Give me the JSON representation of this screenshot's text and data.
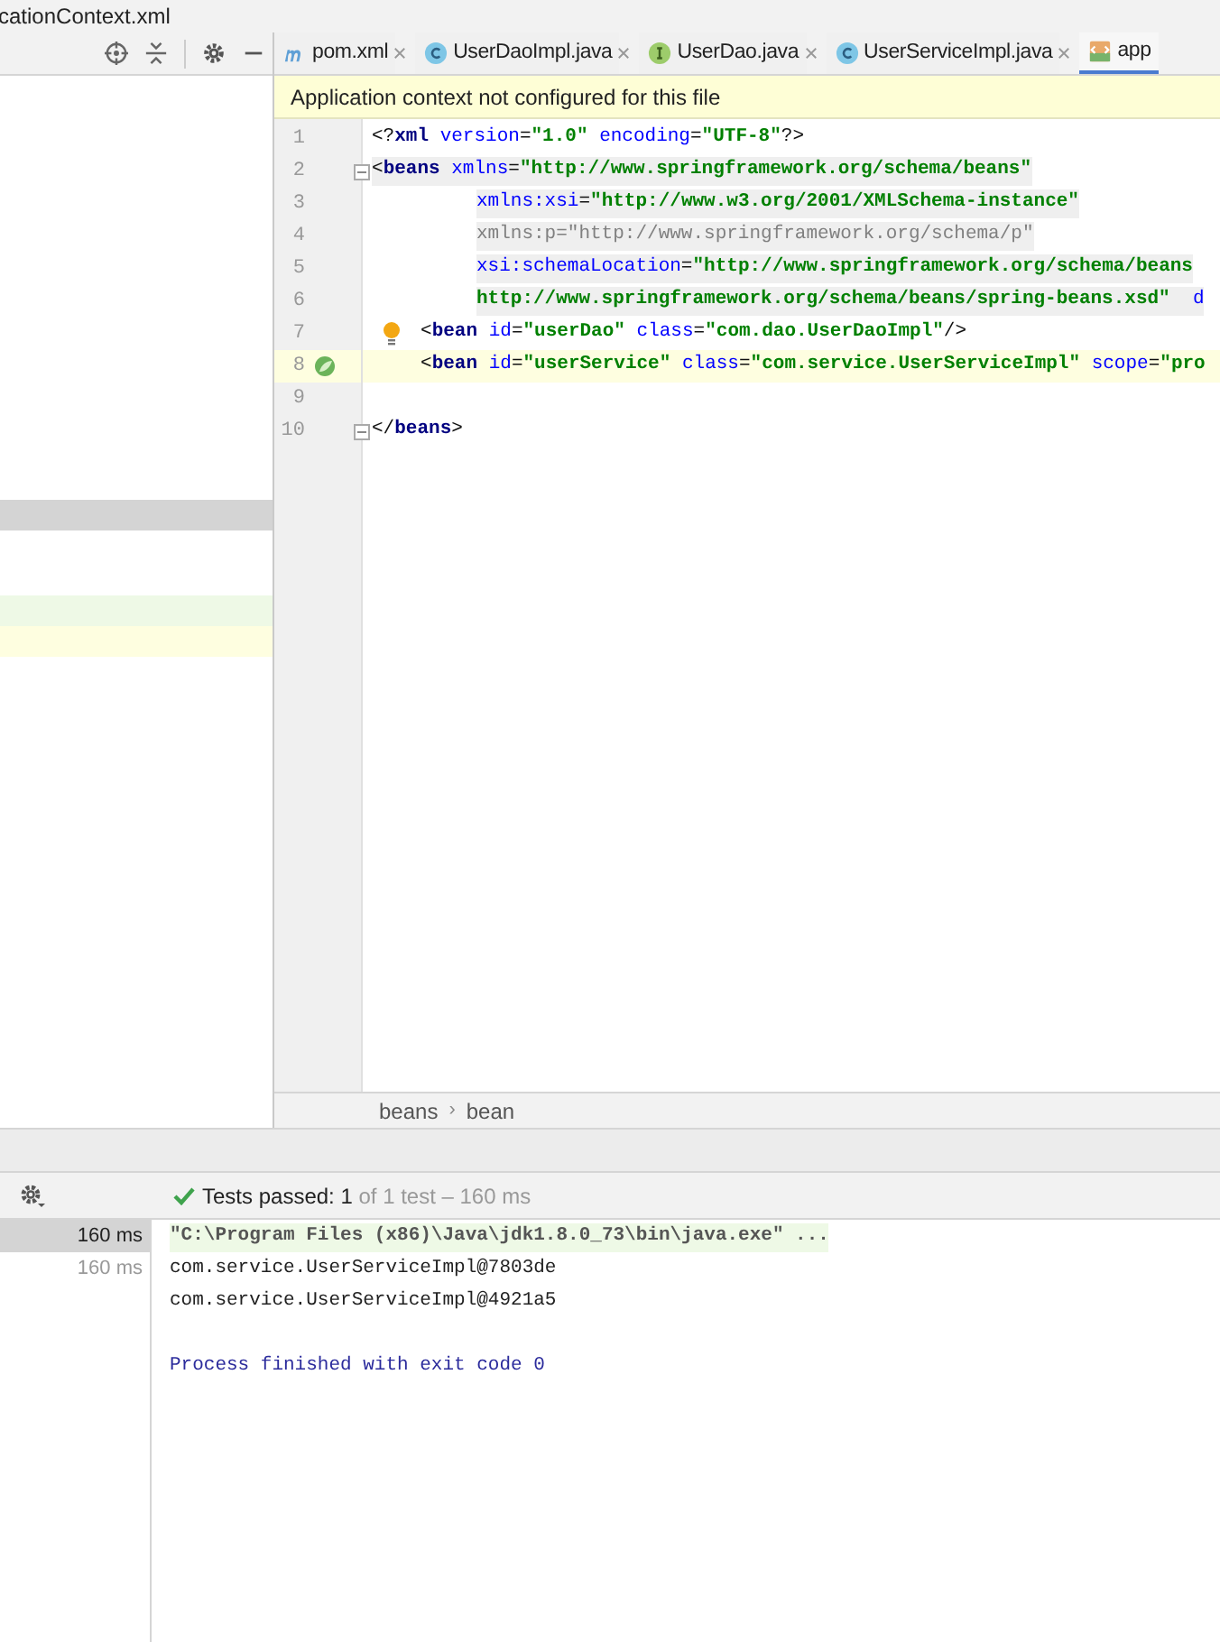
{
  "window": {
    "title": "cationContext.xml"
  },
  "project_panel": {
    "tools": [
      {
        "kind": "locate"
      },
      {
        "kind": "collapse"
      },
      {
        "kind": "settings"
      },
      {
        "kind": "hide"
      }
    ],
    "rows": [
      {
        "kind": "selected"
      },
      {
        "kind": "blank"
      },
      {
        "kind": "blank"
      },
      {
        "kind": "passed"
      },
      {
        "kind": "current"
      }
    ]
  },
  "tabs": [
    {
      "label": "pom.xml",
      "kind": "maven",
      "selected": false,
      "closable": true
    },
    {
      "label": "UserDaoImpl.java",
      "kind": "class",
      "selected": false,
      "closable": true
    },
    {
      "label": "UserDao.java",
      "kind": "interface",
      "selected": false,
      "closable": true
    },
    {
      "label": "UserServiceImpl.java",
      "kind": "class",
      "selected": false,
      "closable": true
    },
    {
      "label": "app",
      "kind": "xml",
      "selected": true,
      "closable": false
    }
  ],
  "banner": "Application context not configured for this file",
  "editor": {
    "lines": [
      {
        "number": "1",
        "kind": "root",
        "fold": false,
        "scope": false,
        "current": false,
        "tokens": [
          {
            "kind": "p",
            "text": "<?"
          },
          {
            "kind": "t",
            "text": "xml"
          },
          {
            "kind": "a",
            "text": " version"
          },
          {
            "kind": "p",
            "text": "="
          },
          {
            "kind": "v",
            "text": "\"1.0\""
          },
          {
            "kind": "a",
            "text": " encoding"
          },
          {
            "kind": "p",
            "text": "="
          },
          {
            "kind": "v",
            "text": "\"UTF-8\""
          },
          {
            "kind": "p",
            "text": "?>"
          }
        ]
      },
      {
        "number": "2",
        "kind": "root",
        "fold": true,
        "scope": true,
        "current": false,
        "tokens": [
          {
            "kind": "p",
            "text": "<"
          },
          {
            "kind": "t",
            "text": "beans"
          },
          {
            "kind": "a",
            "text": " xmlns"
          },
          {
            "kind": "p",
            "text": "="
          },
          {
            "kind": "v",
            "text": "\"http://www.springframework.org/schema/beans\""
          }
        ]
      },
      {
        "number": "3",
        "kind": "continuation",
        "fold": false,
        "scope": true,
        "current": false,
        "tokens": [
          {
            "kind": "a",
            "text": "xmlns:xsi"
          },
          {
            "kind": "p",
            "text": "="
          },
          {
            "kind": "v",
            "text": "\"http://www.w3.org/2001/XMLSchema-instance\""
          }
        ]
      },
      {
        "number": "4",
        "kind": "continuation",
        "fold": false,
        "scope": true,
        "current": false,
        "tokens": [
          {
            "kind": "d",
            "text": "xmlns:p=\"http://www.springframework.org/schema/p\""
          }
        ]
      },
      {
        "number": "5",
        "kind": "continuation",
        "fold": false,
        "scope": true,
        "current": false,
        "tokens": [
          {
            "kind": "a",
            "text": "xsi:schemaLocation"
          },
          {
            "kind": "p",
            "text": "="
          },
          {
            "kind": "v",
            "text": "\"http://www.springframework.org/schema/beans"
          }
        ]
      },
      {
        "number": "6",
        "kind": "continuation",
        "fold": false,
        "scope": true,
        "current": false,
        "tokens": [
          {
            "kind": "v",
            "text": "http://www.springframework.org/schema/beans/spring-beans.xsd\""
          },
          {
            "kind": "a",
            "text": "  d"
          }
        ]
      },
      {
        "number": "7",
        "kind": "child",
        "fold": false,
        "scope": false,
        "current": false,
        "tokens": [
          {
            "kind": "p",
            "text": "<"
          },
          {
            "kind": "t",
            "text": "bean"
          },
          {
            "kind": "a",
            "text": " id"
          },
          {
            "kind": "p",
            "text": "="
          },
          {
            "kind": "v",
            "text": "\"userDao\""
          },
          {
            "kind": "a",
            "text": " class"
          },
          {
            "kind": "p",
            "text": "="
          },
          {
            "kind": "v",
            "text": "\"com.dao.UserDaoImpl\""
          },
          {
            "kind": "p",
            "text": "/>"
          }
        ]
      },
      {
        "number": "8",
        "kind": "child",
        "fold": false,
        "scope": false,
        "current": true,
        "tokens": [
          {
            "kind": "p",
            "text": "<"
          },
          {
            "kind": "t",
            "text": "bean"
          },
          {
            "kind": "a",
            "text": " id"
          },
          {
            "kind": "p",
            "text": "="
          },
          {
            "kind": "v",
            "text": "\"userService\""
          },
          {
            "kind": "a",
            "text": " class"
          },
          {
            "kind": "p",
            "text": "="
          },
          {
            "kind": "v",
            "text": "\"com.service.UserServiceImpl\""
          },
          {
            "kind": "a",
            "text": " scope"
          },
          {
            "kind": "p",
            "text": "="
          },
          {
            "kind": "v",
            "text": "\"pro"
          }
        ]
      },
      {
        "number": "9",
        "kind": "root",
        "fold": false,
        "current": false
      },
      {
        "number": "10",
        "kind": "root",
        "fold": true,
        "scope": false,
        "current": false,
        "tokens": [
          {
            "kind": "p",
            "text": "</"
          },
          {
            "kind": "t",
            "text": "beans"
          },
          {
            "kind": "p",
            "text": ">"
          }
        ]
      }
    ]
  },
  "breadcrumbs": [
    "beans",
    "bean"
  ],
  "breadcrumb_separator": "›",
  "run": {
    "passed_label": "Tests passed:",
    "passed_count": "1",
    "summary": "of 1 test – 160 ms",
    "times": [
      {
        "text": "160 ms",
        "selected": true
      },
      {
        "text": "160 ms",
        "selected": false
      }
    ],
    "console": [
      {
        "kind": "command",
        "text": "\"C:\\Program Files (x86)\\Java\\jdk1.8.0_73\\bin\\java.exe\" ..."
      },
      {
        "kind": "output",
        "text": "com.service.UserServiceImpl@7803de"
      },
      {
        "kind": "output",
        "text": "com.service.UserServiceImpl@4921a5"
      },
      {
        "kind": "blank"
      },
      {
        "kind": "exit",
        "text": "Process finished with exit code 0"
      }
    ]
  }
}
